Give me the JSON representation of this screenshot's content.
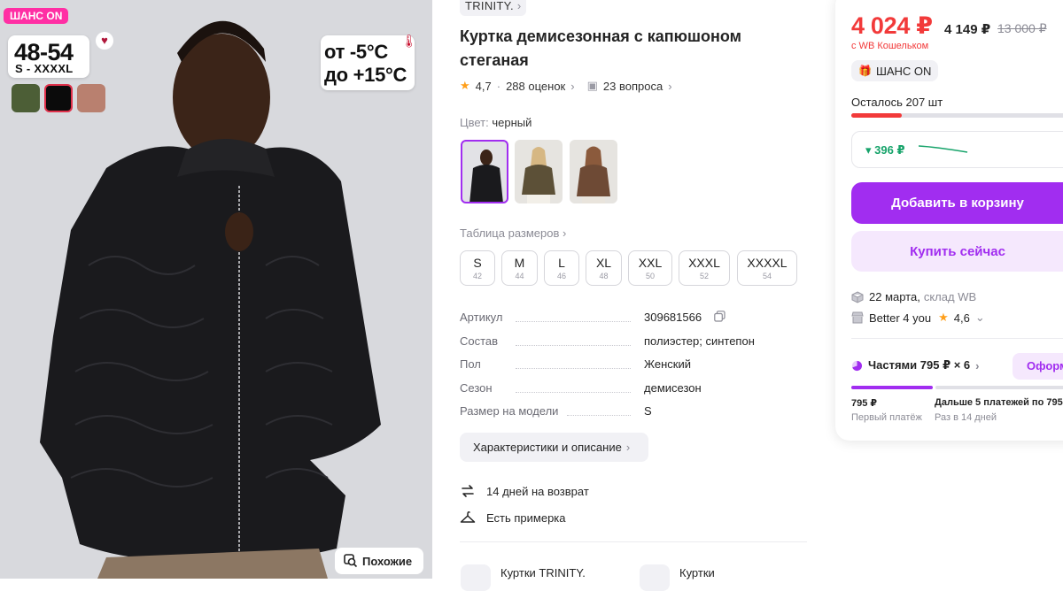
{
  "gallery": {
    "badge": "ШАНС ON",
    "size_range": "48-54",
    "size_letters": "S - XXXXL",
    "swatches": [
      "#4c5e36",
      "#0b0b0b",
      "#b9806f"
    ],
    "temp_min": "от -5°C",
    "temp_max": "до +15°C",
    "similar_label": "Похожие"
  },
  "product": {
    "brand": "TRINITY.",
    "title": "Куртка демисезонная с капюшоном стеганая",
    "rating": "4,7",
    "reviews": "288 оценок",
    "questions": "23 вопроса",
    "color_label": "Цвет:",
    "color_value": "черный",
    "size_table": "Таблица размеров",
    "sizes": [
      {
        "name": "S",
        "ru": "42"
      },
      {
        "name": "M",
        "ru": "44"
      },
      {
        "name": "L",
        "ru": "46"
      },
      {
        "name": "XL",
        "ru": "48"
      },
      {
        "name": "XXL",
        "ru": "50"
      },
      {
        "name": "XXXL",
        "ru": "52"
      },
      {
        "name": "XXXXL",
        "ru": "54"
      }
    ],
    "specs": [
      {
        "k": "Артикул",
        "v": "309681566"
      },
      {
        "k": "Состав",
        "v": "полиэстер; синтепон"
      },
      {
        "k": "Пол",
        "v": "Женский"
      },
      {
        "k": "Сезон",
        "v": "демисезон"
      },
      {
        "k": "Размер на модели",
        "v": "S"
      }
    ],
    "desc_button": "Характеристики и описание",
    "return_text": "14 дней на возврат",
    "fitting_text": "Есть примерка",
    "category_1": "Куртки TRINITY.",
    "category_2": "Куртки"
  },
  "buy": {
    "price": "4 024 ₽",
    "price_no_wallet": "4 149 ₽",
    "old_price": "13 000 ₽",
    "wallet_note": "с WB Кошельком",
    "chance": "ШАНС ON",
    "stock": "Осталось 207 шт",
    "stock_fraction": 0.22,
    "price_drop": "▾ 396 ₽",
    "add_to_cart": "Добавить в корзину",
    "buy_now": "Купить сейчас",
    "delivery_date": "22 марта,",
    "delivery_store": "склад WB",
    "seller": "Better 4 you",
    "seller_rating": "4,6",
    "installments": "Частями 795 ₽ × 6",
    "installments_btn": "Оформ",
    "first_amount": "795 ₽",
    "first_label": "Первый платёж",
    "next_amount": "Дальше 5 платежей по 795",
    "next_label": "Раз в 14 дней",
    "colors": {
      "accent": "#a12df0",
      "price": "#f23a3a",
      "green": "#16a36a"
    }
  }
}
